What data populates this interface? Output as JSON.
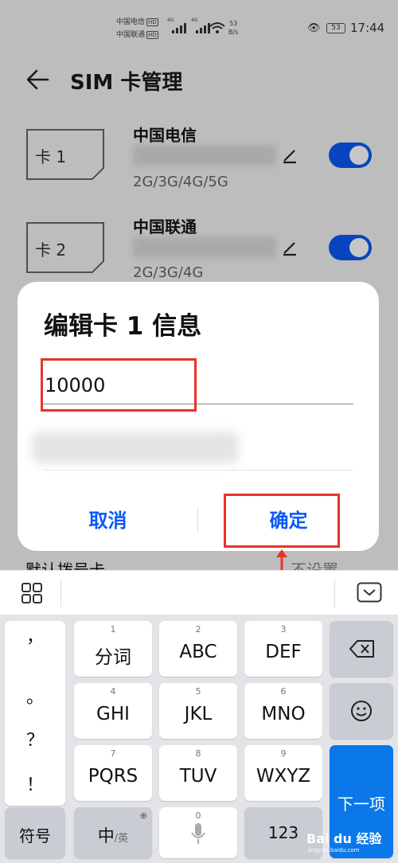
{
  "status_bar": {
    "carrier1": "中国电信",
    "carrier2": "中国联通",
    "hd": "HD",
    "net_type": "4G",
    "speed_value": "53",
    "speed_unit": "B/s",
    "battery": "53",
    "time": "17:44"
  },
  "header": {
    "title": "SIM 卡管理"
  },
  "sims": [
    {
      "icon_label": "卡 1",
      "carrier": "中国电信",
      "networks": "2G/3G/4G/5G",
      "enabled": true
    },
    {
      "icon_label": "卡 2",
      "carrier": "中国联通",
      "networks": "2G/3G/4G",
      "enabled": true
    }
  ],
  "background_row": {
    "left": "默认拨号卡",
    "right": "不设置"
  },
  "dialog": {
    "title": "编辑卡 1 信息",
    "name_value": "10000",
    "cancel_label": "取消",
    "ok_label": "确定"
  },
  "keyboard": {
    "punctuation": [
      "，",
      "。",
      "？",
      "！"
    ],
    "row1": [
      {
        "num": "1",
        "label": "分词"
      },
      {
        "num": "2",
        "label": "ABC"
      },
      {
        "num": "3",
        "label": "DEF"
      }
    ],
    "row2": [
      {
        "num": "4",
        "label": "GHI"
      },
      {
        "num": "5",
        "label": "JKL"
      },
      {
        "num": "6",
        "label": "MNO"
      }
    ],
    "row3": [
      {
        "num": "7",
        "label": "PQRS"
      },
      {
        "num": "8",
        "label": "TUV"
      },
      {
        "num": "9",
        "label": "WXYZ"
      }
    ],
    "symbol_label": "符号",
    "lang_label": "中",
    "lang_sub": "/英",
    "space_num": "0",
    "num_label": "123",
    "next_label": "下一项"
  },
  "watermark": {
    "brand": "Bai du 经验",
    "url": "jingyan.baidu.com"
  },
  "colors": {
    "accent": "#0a59f7",
    "highlight": "#e8332a",
    "key_blue": "#0a78e8"
  }
}
